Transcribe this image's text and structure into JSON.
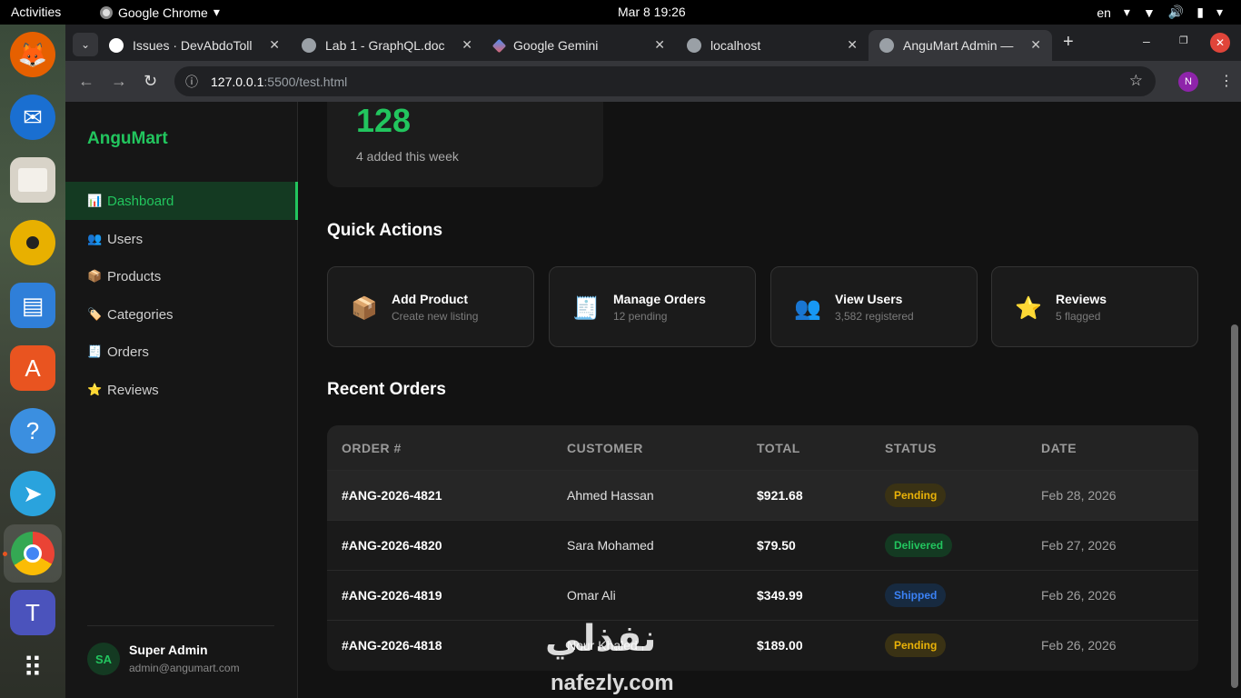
{
  "topbar": {
    "activities": "Activities",
    "app_name": "Google Chrome",
    "clock": "Mar 8  19:26",
    "lang": "en"
  },
  "dock": {
    "items": [
      "firefox-icon",
      "thunderbird-icon",
      "files-icon",
      "rhythmbox-icon",
      "writer-icon",
      "app-center-icon",
      "help-icon",
      "telegram-icon",
      "chrome-icon",
      "teams-icon",
      "app-grid-icon"
    ]
  },
  "browser": {
    "tabs": [
      {
        "title": "Issues · DevAbdoToll"
      },
      {
        "title": "Lab 1 - GraphQL.doc"
      },
      {
        "title": "Google Gemini"
      },
      {
        "title": "localhost"
      },
      {
        "title": "AnguMart Admin —"
      }
    ],
    "url_host": "127.0.0.1",
    "url_path": ":5500/test.html",
    "profile_initial": "N"
  },
  "sidebar": {
    "brand": "AnguMart",
    "items": [
      {
        "emoji": "📊",
        "label": "Dashboard"
      },
      {
        "emoji": "👥",
        "label": "Users"
      },
      {
        "emoji": "📦",
        "label": "Products"
      },
      {
        "emoji": "🏷️",
        "label": "Categories"
      },
      {
        "emoji": "🧾",
        "label": "Orders"
      },
      {
        "emoji": "⭐",
        "label": "Reviews"
      }
    ],
    "user": {
      "initials": "SA",
      "name": "Super Admin",
      "email": "admin@angumart.com"
    }
  },
  "stat": {
    "value": "128",
    "sub": "4 added this week"
  },
  "quick_actions": {
    "title": "Quick Actions",
    "items": [
      {
        "icon": "📦",
        "label": "Add Product",
        "sub": "Create new listing"
      },
      {
        "icon": "🧾",
        "label": "Manage Orders",
        "sub": "12 pending"
      },
      {
        "icon": "👥",
        "label": "View Users",
        "sub": "3,582 registered"
      },
      {
        "icon": "⭐",
        "label": "Reviews",
        "sub": "5 flagged"
      }
    ]
  },
  "orders": {
    "title": "Recent Orders",
    "columns": [
      "ORDER #",
      "CUSTOMER",
      "TOTAL",
      "STATUS",
      "DATE"
    ],
    "rows": [
      {
        "id": "#ANG-2026-4821",
        "customer": "Ahmed Hassan",
        "total": "$921.68",
        "status": "Pending",
        "date": "Feb 28, 2026"
      },
      {
        "id": "#ANG-2026-4820",
        "customer": "Sara Mohamed",
        "total": "$79.50",
        "status": "Delivered",
        "date": "Feb 27, 2026"
      },
      {
        "id": "#ANG-2026-4819",
        "customer": "Omar Ali",
        "total": "$349.99",
        "status": "Shipped",
        "date": "Feb 26, 2026"
      },
      {
        "id": "#ANG-2026-4818",
        "customer": "Nour Khaled",
        "total": "$189.00",
        "status": "Pending",
        "date": "Feb 26, 2026"
      }
    ]
  },
  "watermark": {
    "arabic": "نفذلي",
    "latin": "nafezly.com"
  }
}
